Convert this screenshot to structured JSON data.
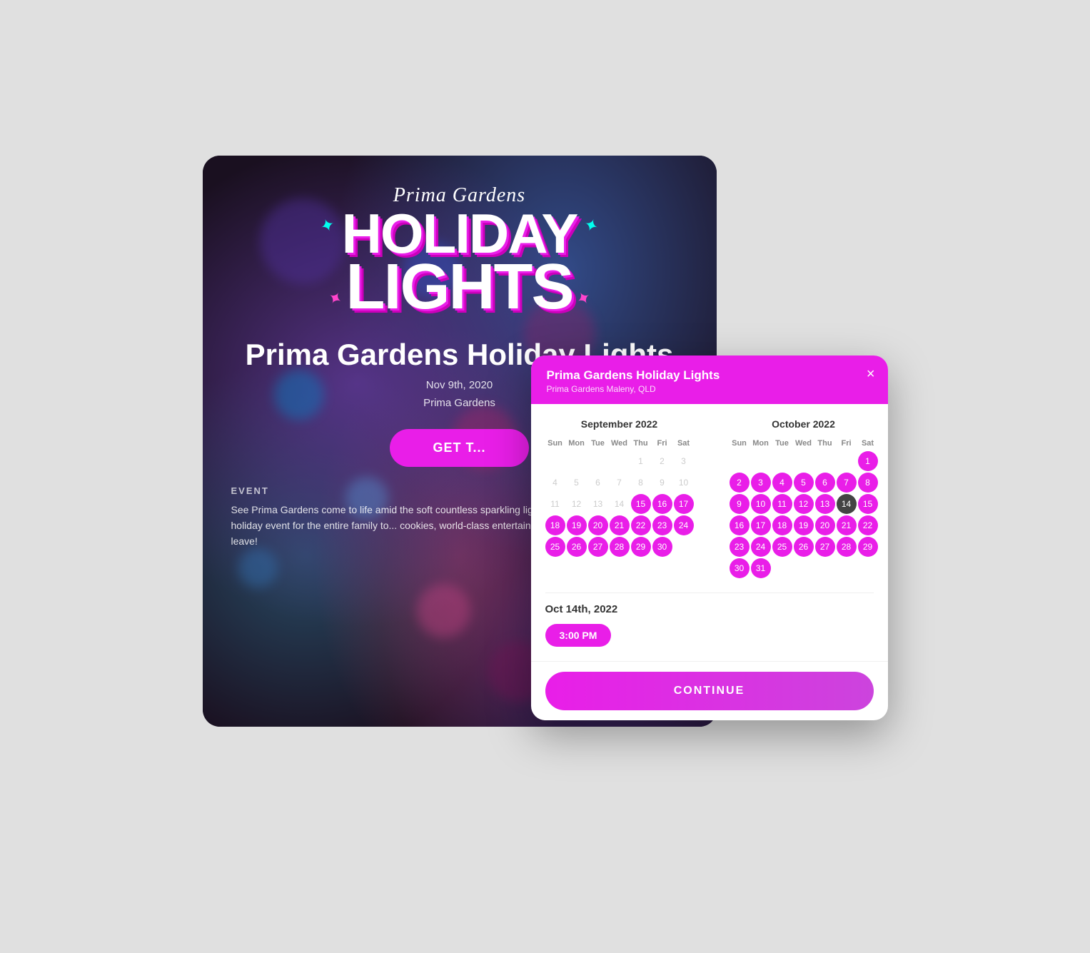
{
  "eventCard": {
    "scriptTitle": "Prima Gardens",
    "holidayText": "HOLIDAY",
    "lightsText": "LIGHTS",
    "eventTitleBig": "Prima Gardens Holiday Lights",
    "eventDate": "Nov 9th, 2020",
    "eventVenue": "Prima Gardens",
    "getTicketsLabel": "GET T...",
    "eventSectionLabel": "EVENT",
    "eventDescription": "See Prima Gardens come to life amid the soft countless sparkling light displays among the p... ultimate holiday event for the entire family to... cookies, world-class entertainers, and dozens... never want to leave!"
  },
  "modal": {
    "title": "Prima Gardens Holiday Lights",
    "subtitle": "Prima Gardens Maleny, QLD",
    "closeIcon": "×",
    "september": {
      "monthLabel": "September 2022",
      "headers": [
        "Sun",
        "Mon",
        "Tue",
        "Wed",
        "Thu",
        "Fri",
        "Sat"
      ],
      "days": [
        {
          "day": "",
          "state": "empty"
        },
        {
          "day": "",
          "state": "empty"
        },
        {
          "day": "",
          "state": "empty"
        },
        {
          "day": "",
          "state": "empty"
        },
        {
          "day": "1",
          "state": "inactive"
        },
        {
          "day": "2",
          "state": "inactive"
        },
        {
          "day": "3",
          "state": "inactive"
        },
        {
          "day": "4",
          "state": "inactive"
        },
        {
          "day": "5",
          "state": "inactive"
        },
        {
          "day": "6",
          "state": "inactive"
        },
        {
          "day": "7",
          "state": "inactive"
        },
        {
          "day": "8",
          "state": "inactive"
        },
        {
          "day": "9",
          "state": "inactive"
        },
        {
          "day": "10",
          "state": "inactive"
        },
        {
          "day": "11",
          "state": "inactive"
        },
        {
          "day": "12",
          "state": "inactive"
        },
        {
          "day": "13",
          "state": "inactive"
        },
        {
          "day": "14",
          "state": "inactive"
        },
        {
          "day": "15",
          "state": "available"
        },
        {
          "day": "16",
          "state": "available"
        },
        {
          "day": "17",
          "state": "available"
        },
        {
          "day": "18",
          "state": "available"
        },
        {
          "day": "19",
          "state": "available"
        },
        {
          "day": "20",
          "state": "available"
        },
        {
          "day": "21",
          "state": "available"
        },
        {
          "day": "22",
          "state": "available"
        },
        {
          "day": "23",
          "state": "available"
        },
        {
          "day": "24",
          "state": "available"
        },
        {
          "day": "25",
          "state": "available"
        },
        {
          "day": "26",
          "state": "available"
        },
        {
          "day": "27",
          "state": "available"
        },
        {
          "day": "28",
          "state": "available"
        },
        {
          "day": "29",
          "state": "available"
        },
        {
          "day": "30",
          "state": "available"
        }
      ]
    },
    "october": {
      "monthLabel": "October 2022",
      "headers": [
        "Sun",
        "Mon",
        "Tue",
        "Wed",
        "Thu",
        "Fri",
        "Sat"
      ],
      "days": [
        {
          "day": "",
          "state": "empty"
        },
        {
          "day": "",
          "state": "empty"
        },
        {
          "day": "",
          "state": "empty"
        },
        {
          "day": "",
          "state": "empty"
        },
        {
          "day": "",
          "state": "empty"
        },
        {
          "day": "",
          "state": "empty"
        },
        {
          "day": "1",
          "state": "available"
        },
        {
          "day": "2",
          "state": "available"
        },
        {
          "day": "3",
          "state": "available"
        },
        {
          "day": "4",
          "state": "available"
        },
        {
          "day": "5",
          "state": "available"
        },
        {
          "day": "6",
          "state": "available"
        },
        {
          "day": "7",
          "state": "available"
        },
        {
          "day": "8",
          "state": "available"
        },
        {
          "day": "9",
          "state": "available"
        },
        {
          "day": "10",
          "state": "available"
        },
        {
          "day": "11",
          "state": "available"
        },
        {
          "day": "12",
          "state": "available"
        },
        {
          "day": "13",
          "state": "available"
        },
        {
          "day": "14",
          "state": "selected"
        },
        {
          "day": "15",
          "state": "available"
        },
        {
          "day": "16",
          "state": "available"
        },
        {
          "day": "17",
          "state": "available"
        },
        {
          "day": "18",
          "state": "available"
        },
        {
          "day": "19",
          "state": "available"
        },
        {
          "day": "20",
          "state": "available"
        },
        {
          "day": "21",
          "state": "available"
        },
        {
          "day": "22",
          "state": "available"
        },
        {
          "day": "23",
          "state": "available"
        },
        {
          "day": "24",
          "state": "available"
        },
        {
          "day": "25",
          "state": "available"
        },
        {
          "day": "26",
          "state": "available"
        },
        {
          "day": "27",
          "state": "available"
        },
        {
          "day": "28",
          "state": "available"
        },
        {
          "day": "29",
          "state": "available"
        },
        {
          "day": "30",
          "state": "available"
        },
        {
          "day": "31",
          "state": "available"
        }
      ]
    },
    "selectedDateLabel": "Oct 14th, 2022",
    "timeSlot": "3:00 PM",
    "continueLabel": "CONTINUE"
  }
}
